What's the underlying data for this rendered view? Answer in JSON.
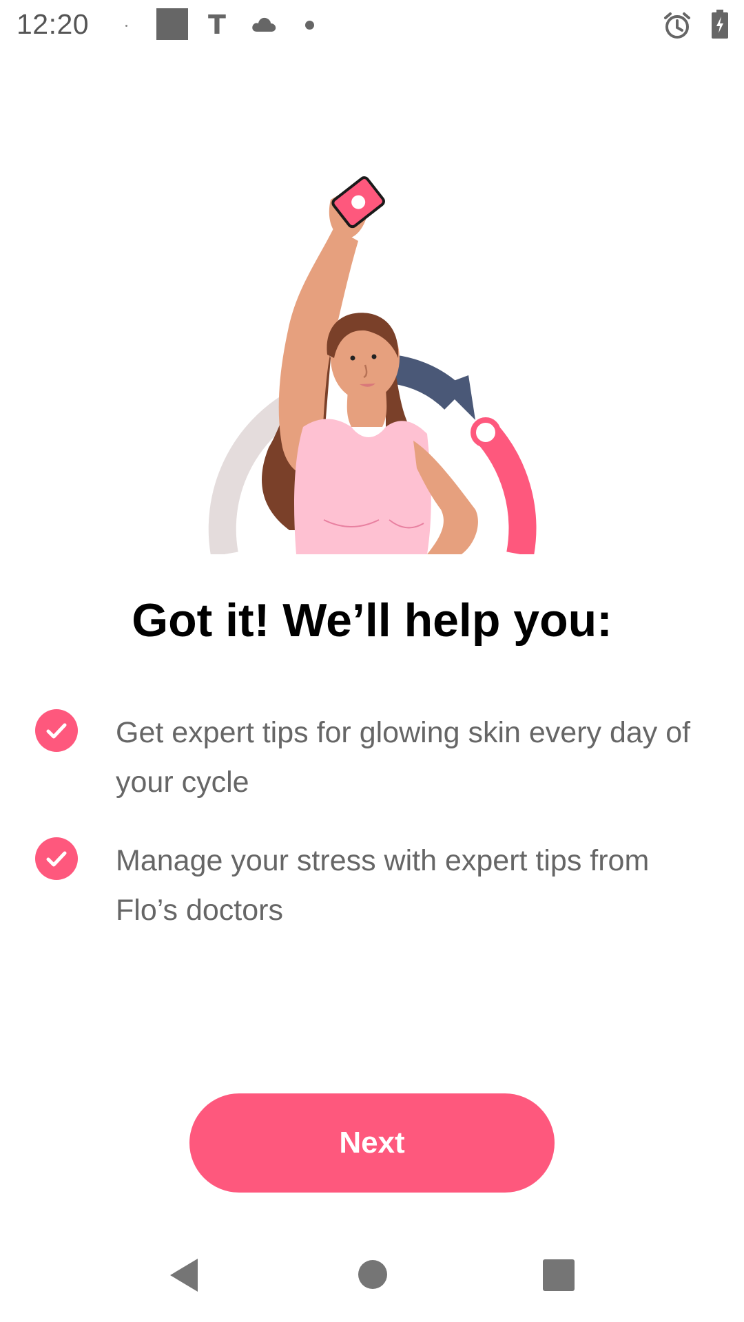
{
  "status_bar": {
    "time": "12:20",
    "notification_icons": [
      "dot-icon",
      "square-icon",
      "t-icon",
      "cloud-icon",
      "dot-icon"
    ],
    "t_glyph": "T",
    "right_icons": [
      "alarm-icon",
      "battery-charging-icon"
    ]
  },
  "illustration": {
    "description_icon": "woman-holding-phone-illustration"
  },
  "title": "Got it! We’ll help you:",
  "benefits": [
    {
      "text": "Get expert tips for glowing skin every day of your cycle",
      "icon": "check-circle-icon"
    },
    {
      "text": "Manage your stress with expert tips from Flo’s doctors",
      "icon": "check-circle-icon"
    }
  ],
  "next_button": {
    "label": "Next"
  },
  "nav_bar": {
    "buttons": [
      "back-icon",
      "home-icon",
      "recents-icon"
    ]
  },
  "colors": {
    "accent": "#fe587d",
    "text_secondary": "#666666",
    "title": "#000000"
  }
}
